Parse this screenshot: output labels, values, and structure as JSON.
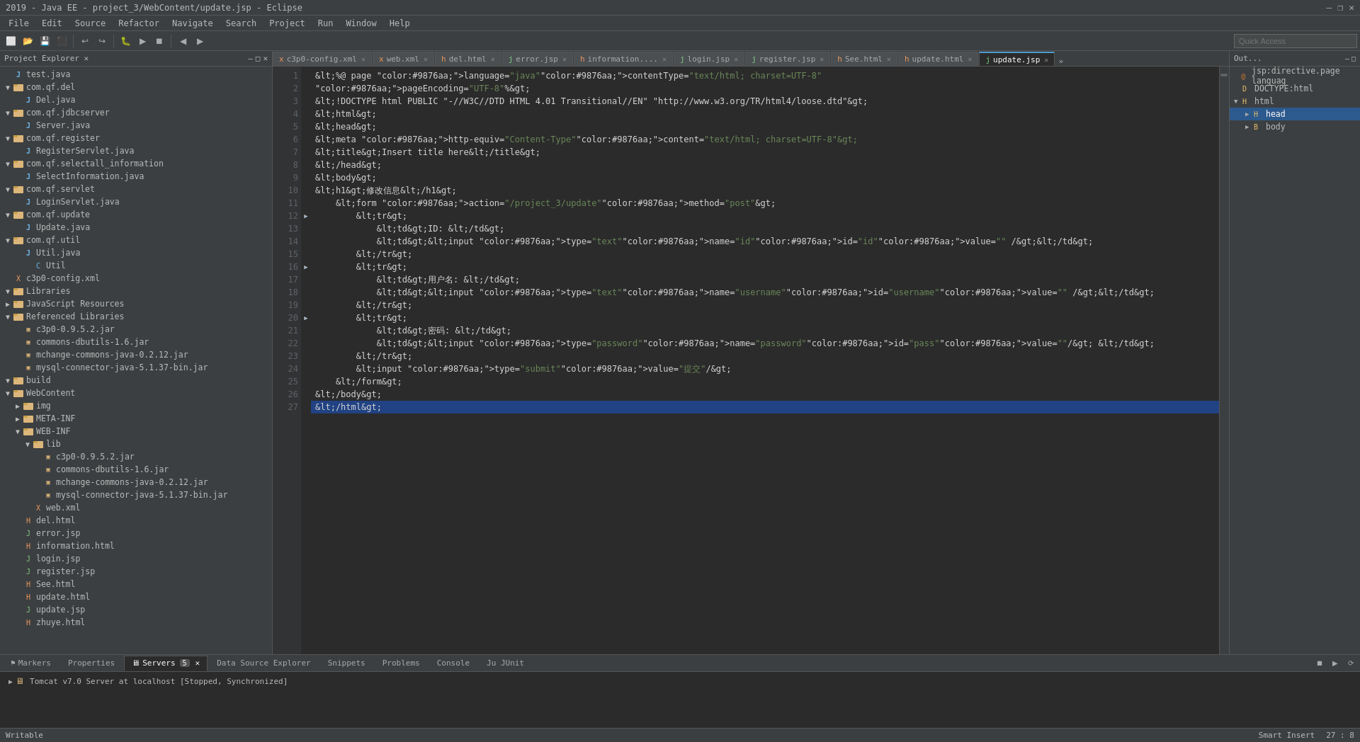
{
  "titlebar": {
    "title": "2019 - Java EE - project_3/WebContent/update.jsp - Eclipse",
    "controls": [
      "—",
      "❐",
      "✕"
    ]
  },
  "menubar": {
    "items": [
      "File",
      "Edit",
      "Source",
      "Refactor",
      "Navigate",
      "Search",
      "Project",
      "Run",
      "Window",
      "Help"
    ]
  },
  "tabs": {
    "items": [
      {
        "label": "c3p0-config.xml",
        "active": false
      },
      {
        "label": "web.xml",
        "active": false
      },
      {
        "label": "del.html",
        "active": false
      },
      {
        "label": "error.jsp",
        "active": false
      },
      {
        "label": "information....",
        "active": false
      },
      {
        "label": "login.jsp",
        "active": false
      },
      {
        "label": "register.jsp",
        "active": false
      },
      {
        "label": "See.html",
        "active": false
      },
      {
        "label": "update.html",
        "active": false
      },
      {
        "label": "update.jsp",
        "active": true
      },
      {
        "label": "»",
        "overflow": true
      }
    ]
  },
  "editor": {
    "lines": [
      {
        "num": 1,
        "content": "<%@ page language=\"java\" contentType=\"text/html; charset=UTF-8\"",
        "fold": false
      },
      {
        "num": 2,
        "content": "    pageEncoding=\"UTF-8\"%>",
        "fold": false
      },
      {
        "num": 3,
        "content": "<!DOCTYPE html PUBLIC \"-//W3C//DTD HTML 4.01 Transitional//EN\" \"http://www.w3.org/TR/html4/loose.dtd\">",
        "fold": false
      },
      {
        "num": 4,
        "content": "<html>",
        "fold": false
      },
      {
        "num": 5,
        "content": "<head>",
        "fold": false
      },
      {
        "num": 6,
        "content": "<meta http-equiv=\"Content-Type\" content=\"text/html; charset=UTF-8\">",
        "fold": false
      },
      {
        "num": 7,
        "content": "<title>Insert title here</title>",
        "fold": false
      },
      {
        "num": 8,
        "content": "</head>",
        "fold": false
      },
      {
        "num": 9,
        "content": "<body>",
        "fold": false
      },
      {
        "num": 10,
        "content": "<h1>修改信息</h1>",
        "fold": false
      },
      {
        "num": 11,
        "content": "    <form action=\"/project_3/update\" method=\"post\">",
        "fold": false
      },
      {
        "num": 12,
        "content": "        <tr>",
        "fold": true
      },
      {
        "num": 13,
        "content": "            <td>ID: </td>",
        "fold": false
      },
      {
        "num": 14,
        "content": "            <td><input type=\"text\" name=\"id\" id=\"id\" value=\"\" /></td>",
        "fold": false
      },
      {
        "num": 15,
        "content": "        </tr>",
        "fold": false
      },
      {
        "num": 16,
        "content": "        <tr>",
        "fold": true
      },
      {
        "num": 17,
        "content": "            <td>用户名: </td>",
        "fold": false
      },
      {
        "num": 18,
        "content": "            <td><input type=\"text\" name=\"username\" id=\"username\" value=\"\" /></td>",
        "fold": false
      },
      {
        "num": 19,
        "content": "        </tr>",
        "fold": false
      },
      {
        "num": 20,
        "content": "        <tr>",
        "fold": true
      },
      {
        "num": 21,
        "content": "            <td>密码: </td>",
        "fold": false
      },
      {
        "num": 22,
        "content": "            <td><input type=\"password\" name=\"password\" id=\"pass\" value=\"\"/> </td>",
        "fold": false
      },
      {
        "num": 23,
        "content": "        </tr>",
        "fold": false
      },
      {
        "num": 24,
        "content": "        <input type=\"submit\" value=\"提交\"/>",
        "fold": false
      },
      {
        "num": 25,
        "content": "    </form>",
        "fold": false
      },
      {
        "num": 26,
        "content": "</body>",
        "fold": false
      },
      {
        "num": 27,
        "content": "</html>",
        "fold": false,
        "active": true
      }
    ]
  },
  "left_panel": {
    "title": "Project Explorer",
    "tree": [
      {
        "indent": 0,
        "label": "test.java",
        "icon": "java",
        "expanded": false
      },
      {
        "indent": 0,
        "label": "com.qf.del",
        "icon": "package",
        "expanded": true
      },
      {
        "indent": 1,
        "label": "Del.java",
        "icon": "java",
        "expanded": false
      },
      {
        "indent": 0,
        "label": "com.qf.jdbcserver",
        "icon": "package",
        "expanded": true
      },
      {
        "indent": 1,
        "label": "Server.java",
        "icon": "java",
        "expanded": false
      },
      {
        "indent": 0,
        "label": "com.qf.register",
        "icon": "package",
        "expanded": true
      },
      {
        "indent": 1,
        "label": "RegisterServlet.java",
        "icon": "java",
        "expanded": false
      },
      {
        "indent": 0,
        "label": "com.qf.selectall_information",
        "icon": "package",
        "expanded": true
      },
      {
        "indent": 1,
        "label": "SelectInformation.java",
        "icon": "java",
        "expanded": false
      },
      {
        "indent": 0,
        "label": "com.qf.servlet",
        "icon": "package",
        "expanded": true
      },
      {
        "indent": 1,
        "label": "LoginServlet.java",
        "icon": "java",
        "expanded": false
      },
      {
        "indent": 0,
        "label": "com.qf.update",
        "icon": "package",
        "expanded": true
      },
      {
        "indent": 1,
        "label": "Update.java",
        "icon": "java",
        "expanded": false
      },
      {
        "indent": 0,
        "label": "com.qf.util",
        "icon": "package",
        "expanded": true
      },
      {
        "indent": 1,
        "label": "Util.java",
        "icon": "java",
        "expanded": false
      },
      {
        "indent": 2,
        "label": "Util",
        "icon": "class",
        "expanded": false
      },
      {
        "indent": 0,
        "label": "c3p0-config.xml",
        "icon": "xml",
        "expanded": false
      },
      {
        "indent": 0,
        "label": "Libraries",
        "icon": "folder",
        "expanded": true
      },
      {
        "indent": 0,
        "label": "JavaScript Resources",
        "icon": "folder",
        "expanded": false
      },
      {
        "indent": 0,
        "label": "Referenced Libraries",
        "icon": "folder",
        "expanded": true
      },
      {
        "indent": 1,
        "label": "c3p0-0.9.5.2.jar",
        "icon": "jar",
        "expanded": false
      },
      {
        "indent": 1,
        "label": "commons-dbutils-1.6.jar",
        "icon": "jar",
        "expanded": false
      },
      {
        "indent": 1,
        "label": "mchange-commons-java-0.2.12.jar",
        "icon": "jar",
        "expanded": false
      },
      {
        "indent": 1,
        "label": "mysql-connector-java-5.1.37-bin.jar",
        "icon": "jar",
        "expanded": false
      },
      {
        "indent": 0,
        "label": "build",
        "icon": "folder",
        "expanded": true
      },
      {
        "indent": 0,
        "label": "WebContent",
        "icon": "folder",
        "expanded": true
      },
      {
        "indent": 1,
        "label": "img",
        "icon": "folder",
        "expanded": false
      },
      {
        "indent": 1,
        "label": "META-INF",
        "icon": "folder",
        "expanded": false
      },
      {
        "indent": 1,
        "label": "WEB-INF",
        "icon": "folder",
        "expanded": true
      },
      {
        "indent": 2,
        "label": "lib",
        "icon": "folder",
        "expanded": true
      },
      {
        "indent": 3,
        "label": "c3p0-0.9.5.2.jar",
        "icon": "jar",
        "expanded": false
      },
      {
        "indent": 3,
        "label": "commons-dbutils-1.6.jar",
        "icon": "jar",
        "expanded": false
      },
      {
        "indent": 3,
        "label": "mchange-commons-java-0.2.12.jar",
        "icon": "jar",
        "expanded": false
      },
      {
        "indent": 3,
        "label": "mysql-connector-java-5.1.37-bin.jar",
        "icon": "jar",
        "expanded": false
      },
      {
        "indent": 2,
        "label": "web.xml",
        "icon": "xml",
        "expanded": false
      },
      {
        "indent": 1,
        "label": "del.html",
        "icon": "html",
        "expanded": false
      },
      {
        "indent": 1,
        "label": "error.jsp",
        "icon": "jsp",
        "expanded": false
      },
      {
        "indent": 1,
        "label": "information.html",
        "icon": "html",
        "expanded": false
      },
      {
        "indent": 1,
        "label": "login.jsp",
        "icon": "jsp",
        "expanded": false
      },
      {
        "indent": 1,
        "label": "register.jsp",
        "icon": "jsp",
        "expanded": false
      },
      {
        "indent": 1,
        "label": "See.html",
        "icon": "html",
        "expanded": false
      },
      {
        "indent": 1,
        "label": "update.html",
        "icon": "html",
        "expanded": false
      },
      {
        "indent": 1,
        "label": "update.jsp",
        "icon": "jsp",
        "expanded": false
      },
      {
        "indent": 1,
        "label": "zhuye.html",
        "icon": "html",
        "expanded": false
      }
    ]
  },
  "right_panel": {
    "title": "Out...",
    "outline": [
      {
        "indent": 0,
        "label": "jsp:directive.page languag"
      },
      {
        "indent": 0,
        "label": "DOCTYPE:html"
      },
      {
        "indent": 0,
        "label": "html",
        "expanded": true
      },
      {
        "indent": 1,
        "label": "head",
        "expanded": false
      },
      {
        "indent": 1,
        "label": "body",
        "expanded": false
      }
    ]
  },
  "bottom_tabs": {
    "items": [
      {
        "label": "Markers",
        "active": false
      },
      {
        "label": "Properties",
        "active": false
      },
      {
        "label": "Servers",
        "active": true,
        "badge": "5"
      },
      {
        "label": "Data Source Explorer",
        "active": false
      },
      {
        "label": "Snippets",
        "active": false
      },
      {
        "label": "Problems",
        "active": false
      },
      {
        "label": "Console",
        "active": false
      },
      {
        "label": "JU JUnit",
        "active": false
      }
    ]
  },
  "bottom_panel": {
    "server_entry": "Tomcat v7.0 Server at localhost  [Stopped, Synchronized]"
  },
  "statusbar": {
    "writable": "Writable",
    "insert_mode": "Smart Insert",
    "position": "27 : 8"
  }
}
